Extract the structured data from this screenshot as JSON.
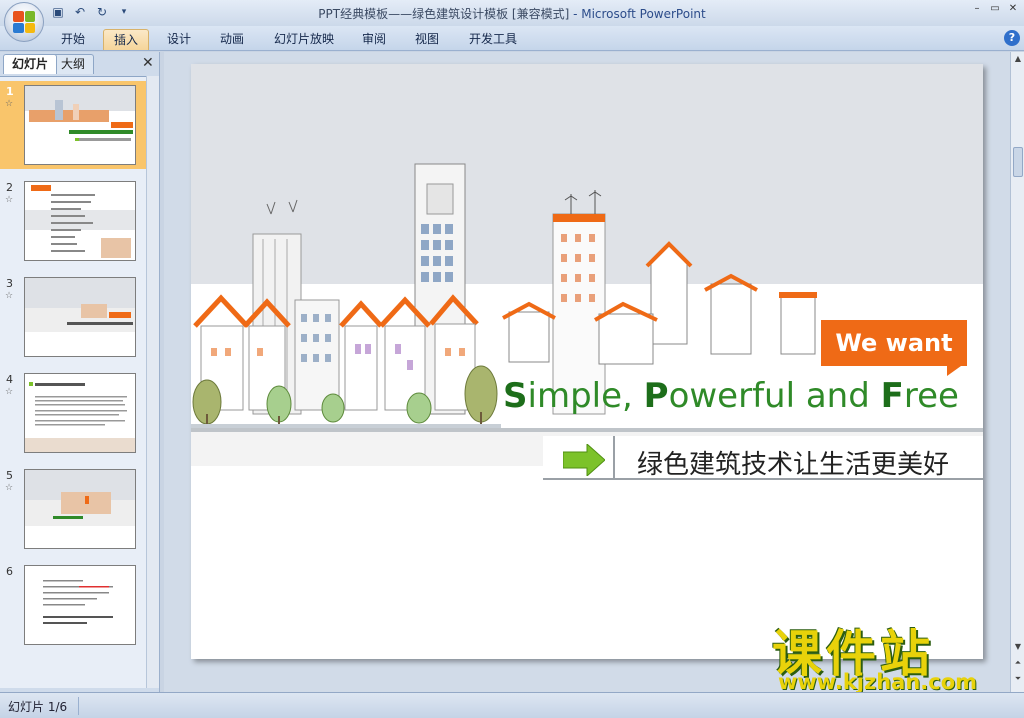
{
  "window": {
    "title": "PPT经典模板——绿色建筑设计模板 [兼容模式]",
    "app_name": " - Microsoft PowerPoint"
  },
  "ribbon": {
    "tabs": [
      "开始",
      "插入",
      "设计",
      "动画",
      "幻灯片放映",
      "审阅",
      "视图",
      "开发工具"
    ],
    "active_tab": "插入"
  },
  "panel": {
    "tab_slides": "幻灯片",
    "tab_outline": "大纲",
    "close": "✕",
    "thumbnails": [
      {
        "num": "1",
        "star": "☆",
        "selected": true
      },
      {
        "num": "2",
        "star": "☆"
      },
      {
        "num": "3",
        "star": "☆"
      },
      {
        "num": "4",
        "star": "☆"
      },
      {
        "num": "5",
        "star": "☆"
      },
      {
        "num": "6"
      }
    ]
  },
  "slide": {
    "badge": "We want",
    "headline": "Simple, Powerful and Free",
    "subtitle": "绿色建筑技术让生活更美好"
  },
  "watermark": {
    "logo": "课件站",
    "url": "www.kjzhan.com"
  },
  "status": {
    "slide_counter": "幻灯片 1/6"
  },
  "colors": {
    "accent_orange": "#ef6a16",
    "headline_green": "#2f8a28",
    "arrow_green": "#7cc22a"
  }
}
